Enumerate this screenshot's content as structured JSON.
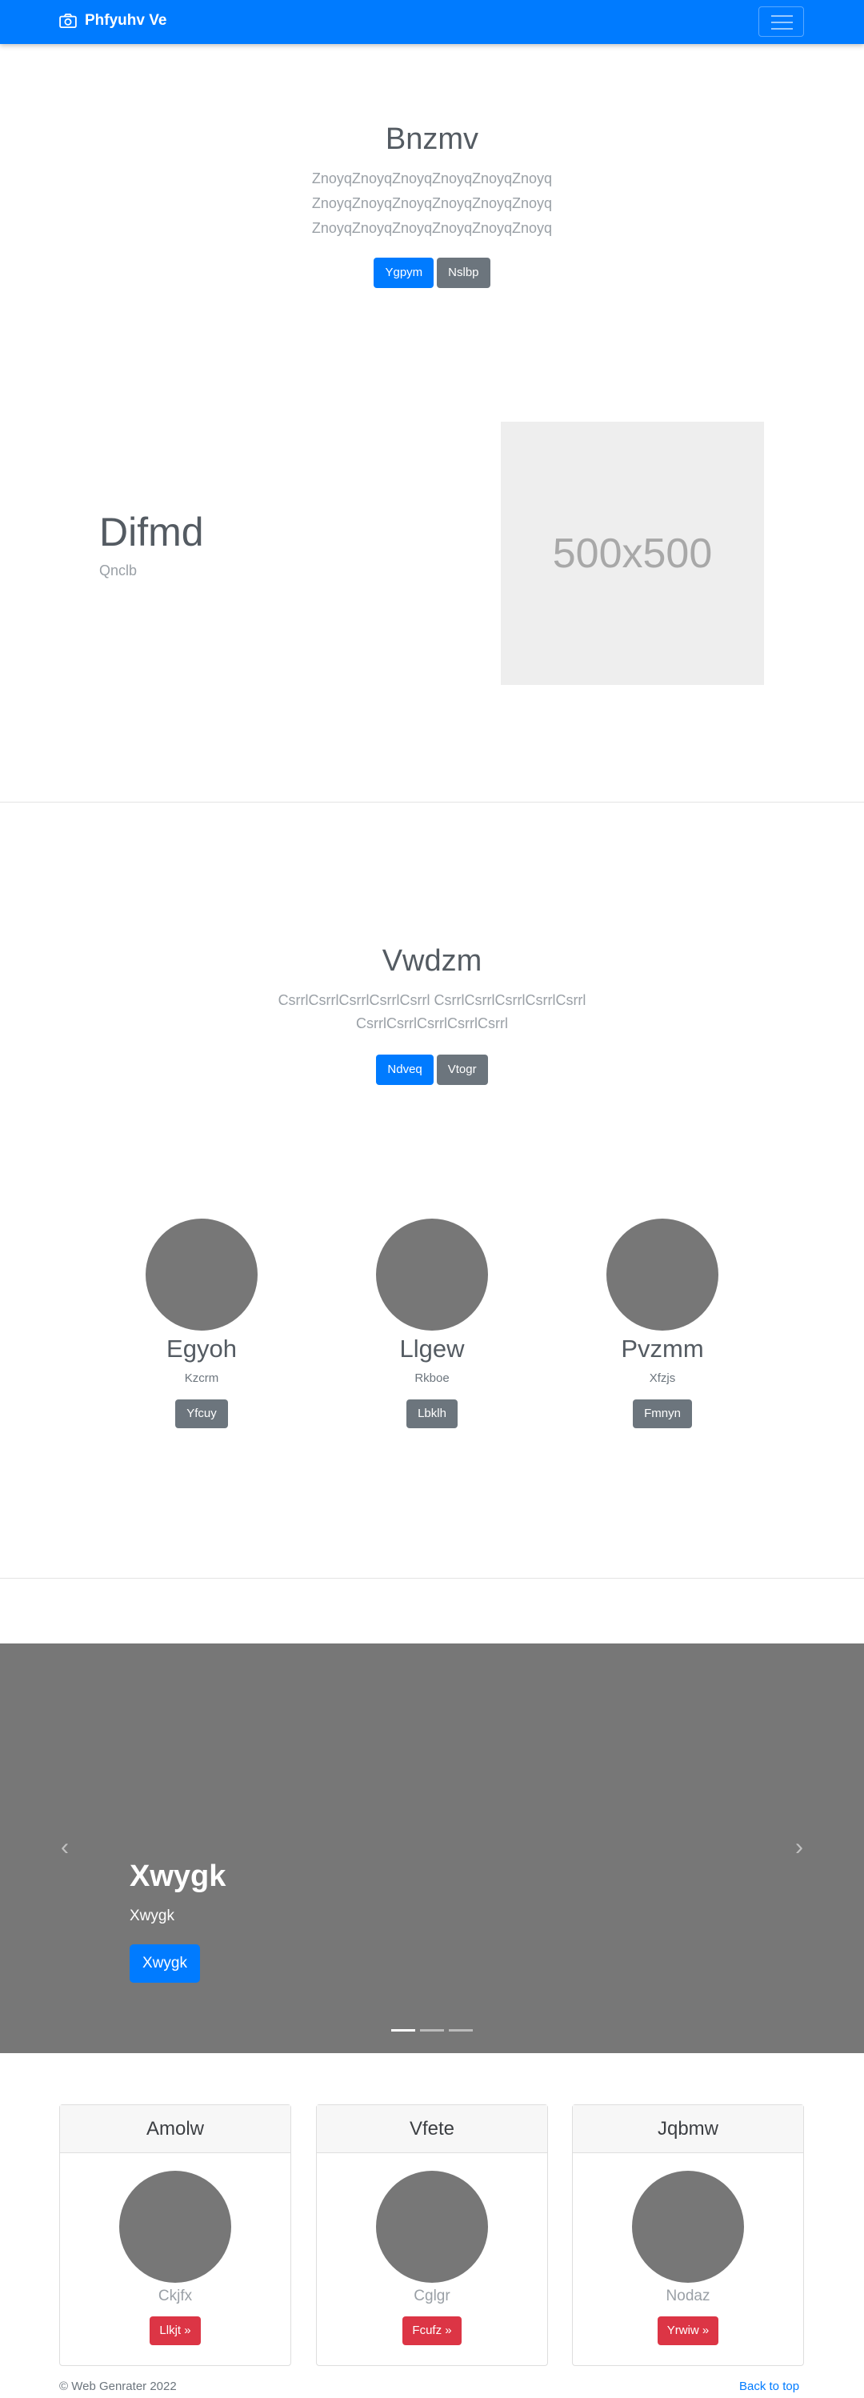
{
  "navbar": {
    "brand": "Phfyuhv Ve",
    "brand_icon": "camera-icon",
    "toggler_icon": "hamburger-menu-icon",
    "color": "#007bff"
  },
  "hero1": {
    "title": "Bnzmv",
    "lead_lines": [
      "ZnoyqZnoyqZnoyqZnoyqZnoyqZnoyq",
      "ZnoyqZnoyqZnoyqZnoyqZnoyqZnoyq",
      "ZnoyqZnoyqZnoyqZnoyqZnoyqZnoyq"
    ],
    "primary_label": "Ygpym",
    "secondary_label": "Nslbp"
  },
  "feature": {
    "title": "Difmd",
    "subtitle": "Qnclb",
    "placeholder_text": "500x500"
  },
  "hero2": {
    "title": "Vwdzm",
    "lead_lines": [
      "CsrrlCsrrlCsrrlCsrrlCsrrl CsrrlCsrrlCsrrlCsrrlCsrrl",
      "CsrrlCsrrlCsrrlCsrrlCsrrl"
    ],
    "primary_label": "Ndveq",
    "secondary_label": "Vtogr"
  },
  "team": [
    {
      "name": "Egyoh",
      "role": "Kzcrm",
      "button": "Yfcuy"
    },
    {
      "name": "Llgew",
      "role": "Rkboe",
      "button": "Lbklh"
    },
    {
      "name": "Pvzmm",
      "role": "Xfzjs",
      "button": "Fmnyn"
    }
  ],
  "carousel": {
    "title": "Xwygk",
    "text": "Xwygk",
    "button": "Xwygk",
    "prev_icon": "chevron-left-icon",
    "next_icon": "chevron-right-icon",
    "active_index": 0,
    "slide_count": 3
  },
  "cards": [
    {
      "header": "Amolw",
      "caption": "Ckjfx",
      "button": "Llkjt »"
    },
    {
      "header": "Vfete",
      "caption": "Cglgr",
      "button": "Fcufz »"
    },
    {
      "header": "Jqbmw",
      "caption": "Nodaz",
      "button": "Yrwiw »"
    }
  ],
  "footer": {
    "copyright": "© Web Genrater 2022",
    "back_to_top": "Back to top"
  }
}
